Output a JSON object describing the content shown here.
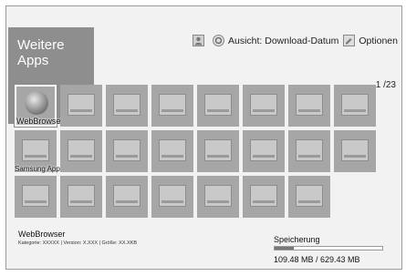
{
  "title": "Weitere Apps",
  "toolbar": {
    "view_label": "Ausicht: Download-Datum",
    "options_label": "Optionen"
  },
  "page_indicator": "1 /23",
  "tiles": {
    "webbrowser_label": "WebBrowser",
    "samsung_apps_label": "Samsung Apps"
  },
  "info": {
    "name": "WebBrowser",
    "meta": "Kategorie: XXXXX  |  Version: X.XXX  |  Größe: XX.XKB"
  },
  "storage": {
    "label": "Speicherung",
    "value": "109.48 MB / 629.43 MB",
    "used_fraction": 0.174
  }
}
